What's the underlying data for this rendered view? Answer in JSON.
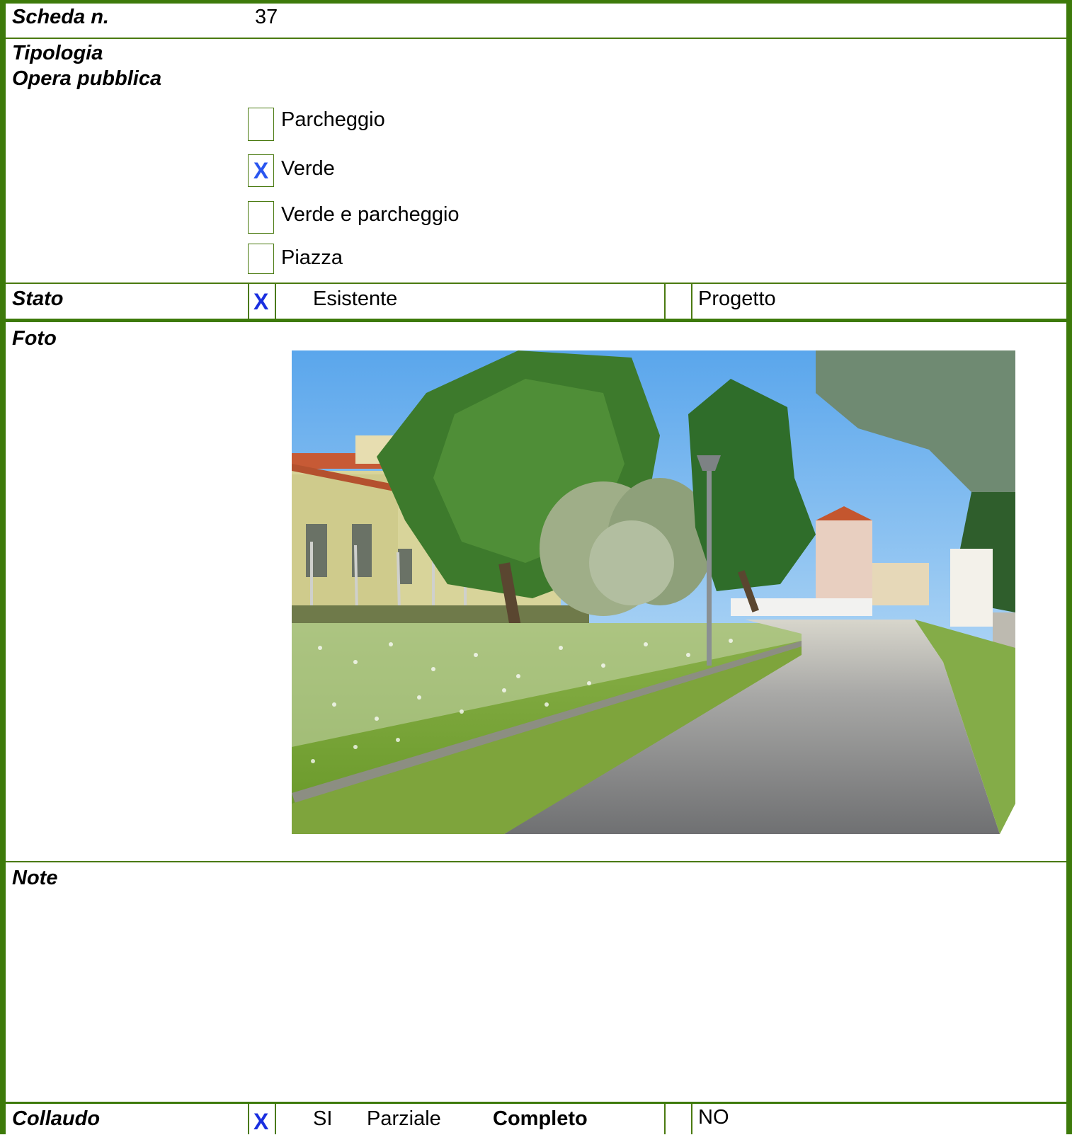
{
  "scheda": {
    "label": "Scheda n.",
    "value": "37"
  },
  "tipologia": {
    "label_line1": "Tipologia",
    "label_line2": "Opera pubblica",
    "options": [
      {
        "label": "Parcheggio",
        "checked": false,
        "mark": ""
      },
      {
        "label": "Verde",
        "checked": true,
        "mark": "X"
      },
      {
        "label": "Verde e parcheggio",
        "checked": false,
        "mark": ""
      },
      {
        "label": "Piazza",
        "checked": false,
        "mark": ""
      }
    ]
  },
  "stato": {
    "label": "Stato",
    "mark": "X",
    "option1": "Esistente",
    "option2": "Progetto"
  },
  "foto": {
    "label": "Foto"
  },
  "note": {
    "label": "Note"
  },
  "collaudo": {
    "label": "Collaudo",
    "mark": "X",
    "si": "SI",
    "parziale": "Parziale",
    "completo": "Completo",
    "no": "NO"
  },
  "colors": {
    "border": "#4a7a10",
    "check_mark": "#2a56f0"
  }
}
